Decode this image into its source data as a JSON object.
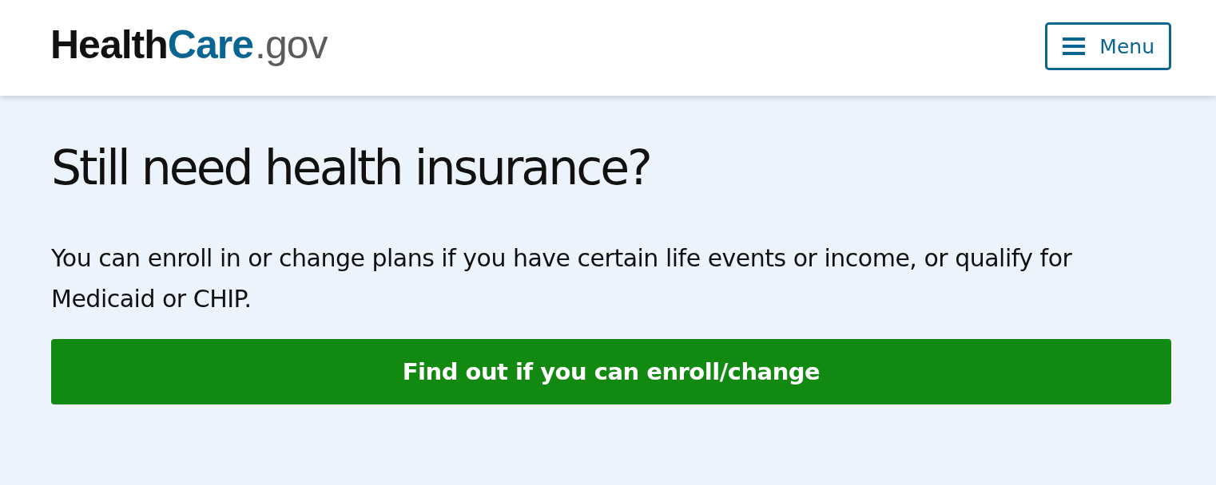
{
  "header": {
    "logo": [
      "Health",
      "Care",
      ".gov"
    ],
    "menu_button": "Menu"
  },
  "hero": {
    "heading": "Still need health insurance?",
    "text": "You can enroll in or change plans if you have certain life events or income, or qualify for Medicaid or CHIP.",
    "button": "Find out if you can enroll/change"
  }
}
